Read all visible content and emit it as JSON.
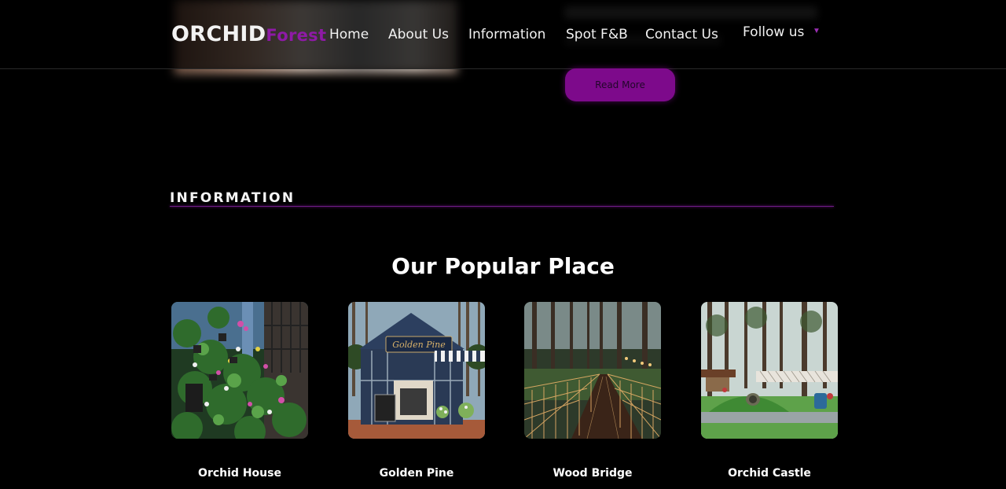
{
  "header": {
    "logo_primary": "ORCHID",
    "logo_secondary": "Forest",
    "nav": [
      {
        "label": "Home"
      },
      {
        "label": "About Us"
      },
      {
        "label": "Information"
      },
      {
        "label": "Spot F&B"
      },
      {
        "label": "Contact Us"
      },
      {
        "label": "Follow us"
      }
    ],
    "follow_dropdown_icon": "caret-down-icon"
  },
  "previous_section": {
    "read_more_label": "Read More"
  },
  "information": {
    "heading": "INFORMATION",
    "popular_title": "Our Popular Place",
    "places": [
      {
        "name": "Orchid House"
      },
      {
        "name": "Golden Pine"
      },
      {
        "name": "Wood Bridge"
      },
      {
        "name": "Orchid Castle"
      }
    ],
    "golden_pine_sign": "Golden Pine"
  },
  "colors": {
    "background": "#000000",
    "accent": "#7d0a8b",
    "logo_accent": "#8e1aa6",
    "text": "#ffffff"
  }
}
